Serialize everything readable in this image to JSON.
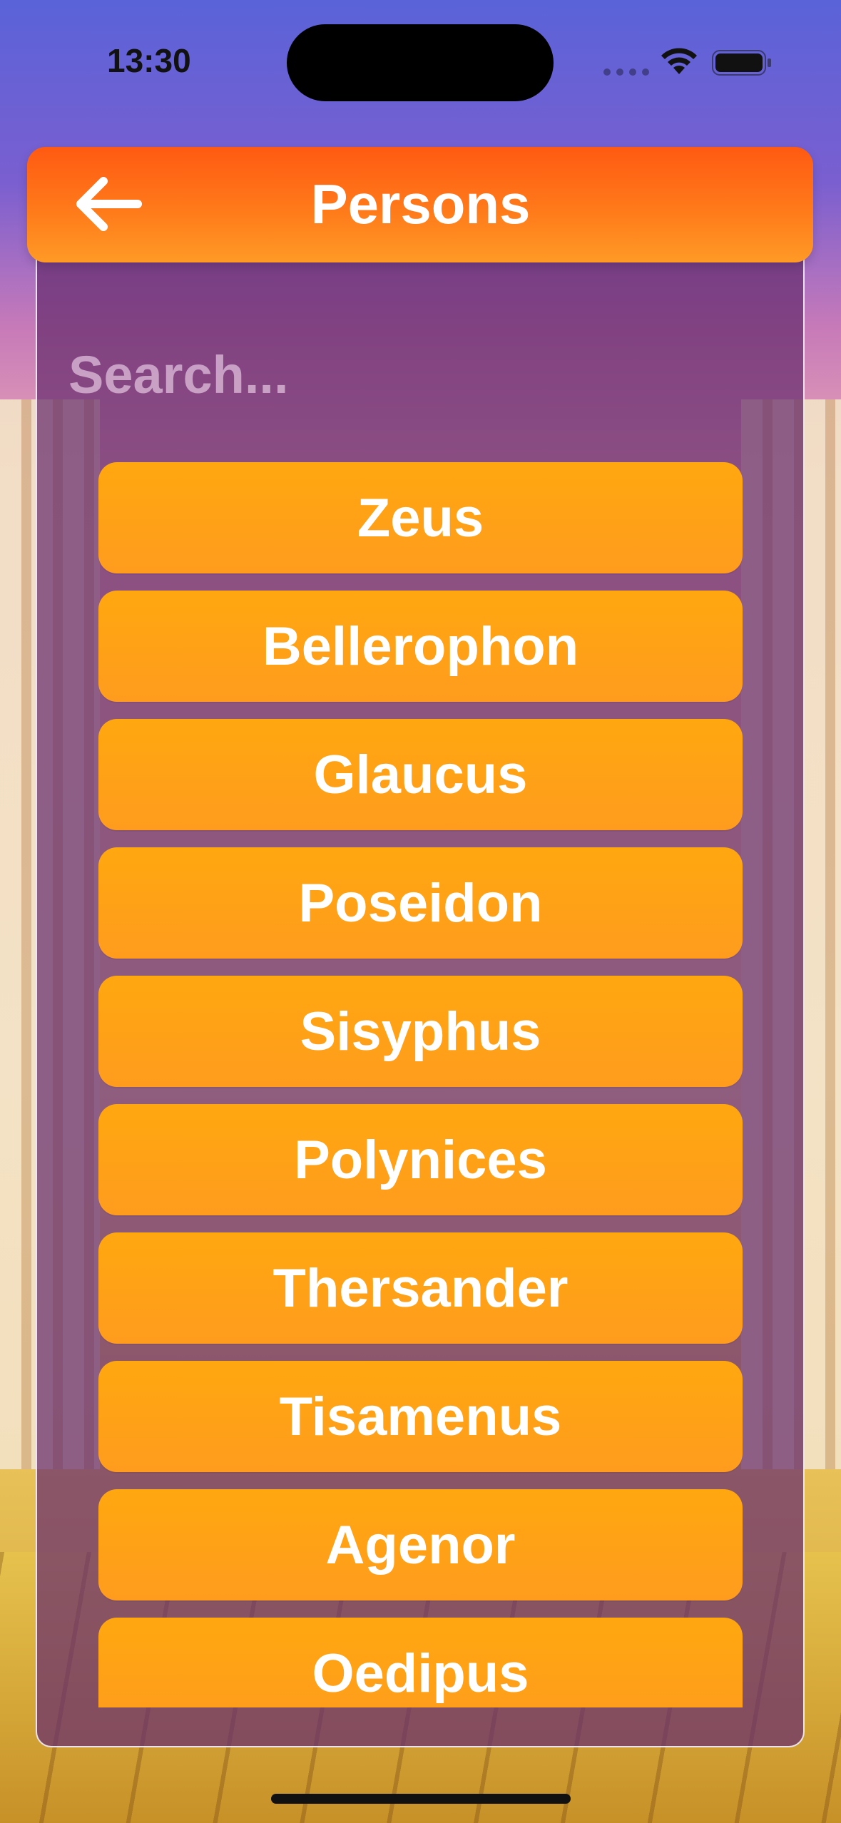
{
  "status_bar": {
    "time": "13:30"
  },
  "header": {
    "title": "Persons",
    "back_icon": "arrow-left-icon"
  },
  "search": {
    "placeholder": "Search...",
    "value": ""
  },
  "persons": [
    "Zeus",
    "Bellerophon",
    "Glaucus",
    "Poseidon",
    "Sisyphus",
    "Polynices",
    "Thersander",
    "Tisamenus",
    "Agenor",
    "Oedipus"
  ],
  "colors": {
    "header_orange": "#ff6a15",
    "button_orange": "#ffa116",
    "panel_purple": "#662d6e"
  }
}
